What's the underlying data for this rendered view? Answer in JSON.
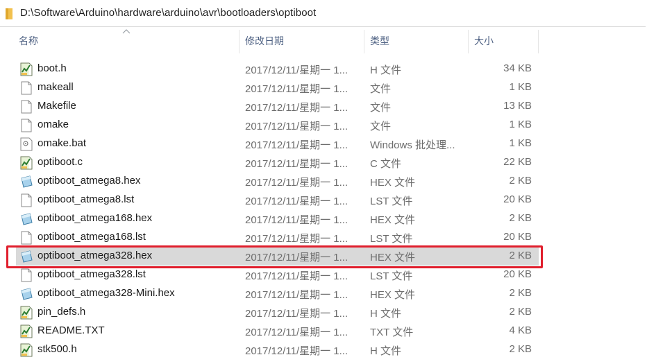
{
  "address_bar": {
    "path": "D:\\Software\\Arduino\\hardware\\arduino\\avr\\bootloaders\\optiboot"
  },
  "columns": {
    "name": "名称",
    "date": "修改日期",
    "type": "类型",
    "size": "大小"
  },
  "colors": {
    "highlight_border": "#e01e2c",
    "selected_row": "#d9d9d9",
    "header_text": "#4d6082"
  },
  "files": [
    {
      "name": "boot.h",
      "date": "2017/12/11/星期一 1...",
      "type": "H 文件",
      "size": "34 KB",
      "icon": "c-source-icon"
    },
    {
      "name": "makeall",
      "date": "2017/12/11/星期一 1...",
      "type": "文件",
      "size": "1 KB",
      "icon": "blank-file-icon"
    },
    {
      "name": "Makefile",
      "date": "2017/12/11/星期一 1...",
      "type": "文件",
      "size": "13 KB",
      "icon": "blank-file-icon"
    },
    {
      "name": "omake",
      "date": "2017/12/11/星期一 1...",
      "type": "文件",
      "size": "1 KB",
      "icon": "blank-file-icon"
    },
    {
      "name": "omake.bat",
      "date": "2017/12/11/星期一 1...",
      "type": "Windows 批处理...",
      "size": "1 KB",
      "icon": "batch-file-icon"
    },
    {
      "name": "optiboot.c",
      "date": "2017/12/11/星期一 1...",
      "type": "C 文件",
      "size": "22 KB",
      "icon": "c-source-icon"
    },
    {
      "name": "optiboot_atmega8.hex",
      "date": "2017/12/11/星期一 1...",
      "type": "HEX 文件",
      "size": "2 KB",
      "icon": "hex-file-icon"
    },
    {
      "name": "optiboot_atmega8.lst",
      "date": "2017/12/11/星期一 1...",
      "type": "LST 文件",
      "size": "20 KB",
      "icon": "blank-file-icon"
    },
    {
      "name": "optiboot_atmega168.hex",
      "date": "2017/12/11/星期一 1...",
      "type": "HEX 文件",
      "size": "2 KB",
      "icon": "hex-file-icon"
    },
    {
      "name": "optiboot_atmega168.lst",
      "date": "2017/12/11/星期一 1...",
      "type": "LST 文件",
      "size": "20 KB",
      "icon": "blank-file-icon"
    },
    {
      "name": "optiboot_atmega328.hex",
      "date": "2017/12/11/星期一 1...",
      "type": "HEX 文件",
      "size": "2 KB",
      "icon": "hex-file-icon",
      "selected": true
    },
    {
      "name": "optiboot_atmega328.lst",
      "date": "2017/12/11/星期一 1...",
      "type": "LST 文件",
      "size": "20 KB",
      "icon": "blank-file-icon"
    },
    {
      "name": "optiboot_atmega328-Mini.hex",
      "date": "2017/12/11/星期一 1...",
      "type": "HEX 文件",
      "size": "2 KB",
      "icon": "hex-file-icon"
    },
    {
      "name": "pin_defs.h",
      "date": "2017/12/11/星期一 1...",
      "type": "H 文件",
      "size": "2 KB",
      "icon": "c-source-icon"
    },
    {
      "name": "README.TXT",
      "date": "2017/12/11/星期一 1...",
      "type": "TXT 文件",
      "size": "4 KB",
      "icon": "c-source-icon"
    },
    {
      "name": "stk500.h",
      "date": "2017/12/11/星期一 1...",
      "type": "H 文件",
      "size": "2 KB",
      "icon": "c-source-icon"
    }
  ]
}
